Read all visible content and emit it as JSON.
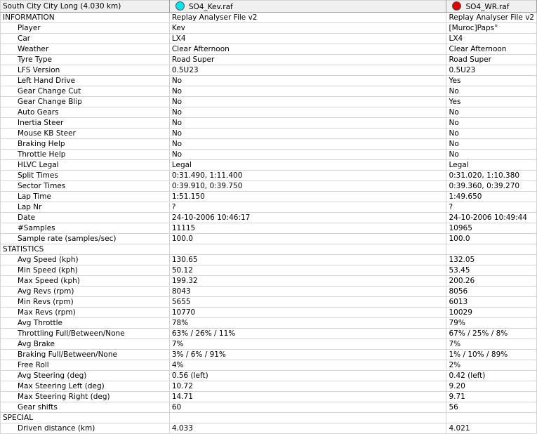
{
  "header": {
    "track": "South City City Long (4.030 km)",
    "file1": {
      "name": "SO4_Kev.raf",
      "color": "#00e5ee",
      "icon": "cyan-dot-icon"
    },
    "file2": {
      "name": "SO4_WR.raf",
      "color": "#e00000",
      "icon": "red-dot-icon"
    }
  },
  "rows": [
    {
      "label": "INFORMATION",
      "section": true,
      "v1": "Replay Analyser File v2",
      "v2": "Replay Analyser File v2"
    },
    {
      "label": "Player",
      "v1": "Kev",
      "v2": "[Muroc]Paps°"
    },
    {
      "label": "Car",
      "v1": "LX4",
      "v2": "LX4"
    },
    {
      "label": "Weather",
      "v1": "Clear Afternoon",
      "v2": "Clear Afternoon"
    },
    {
      "label": "Tyre Type",
      "v1": "Road Super",
      "v2": "Road Super"
    },
    {
      "label": "LFS Version",
      "v1": "0.5U23",
      "v2": "0.5U23"
    },
    {
      "label": "Left Hand Drive",
      "v1": "No",
      "v2": "Yes"
    },
    {
      "label": "Gear Change Cut",
      "v1": "No",
      "v2": "No"
    },
    {
      "label": "Gear Change Blip",
      "v1": "No",
      "v2": "Yes"
    },
    {
      "label": "Auto Gears",
      "v1": "No",
      "v2": "No"
    },
    {
      "label": "Inertia Steer",
      "v1": "No",
      "v2": "No"
    },
    {
      "label": "Mouse KB Steer",
      "v1": "No",
      "v2": "No"
    },
    {
      "label": "Braking Help",
      "v1": "No",
      "v2": "No"
    },
    {
      "label": "Throttle Help",
      "v1": "No",
      "v2": "No"
    },
    {
      "label": "HLVC Legal",
      "v1": "Legal",
      "v2": "Legal"
    },
    {
      "label": "Split Times",
      "v1": "0:31.490, 1:11.400",
      "v2": "0:31.020, 1:10.380"
    },
    {
      "label": "Sector Times",
      "v1": "0:39.910, 0:39.750",
      "v2": "0:39.360, 0:39.270"
    },
    {
      "label": "Lap Time",
      "v1": "1:51.150",
      "v2": "1:49.650"
    },
    {
      "label": "Lap Nr",
      "v1": "?",
      "v2": "?"
    },
    {
      "label": "Date",
      "v1": "24-10-2006 10:46:17",
      "v2": "24-10-2006 10:49:44"
    },
    {
      "label": "#Samples",
      "v1": "11115",
      "v2": "10965"
    },
    {
      "label": "Sample rate (samples/sec)",
      "v1": "100.0",
      "v2": "100.0"
    },
    {
      "label": "STATISTICS",
      "section": true,
      "v1": "",
      "v2": ""
    },
    {
      "label": "Avg Speed (kph)",
      "v1": "130.65",
      "v2": "132.05"
    },
    {
      "label": "Min Speed (kph)",
      "v1": "50.12",
      "v2": "53.45"
    },
    {
      "label": "Max Speed (kph)",
      "v1": "199.32",
      "v2": "200.26"
    },
    {
      "label": "Avg Revs (rpm)",
      "v1": "8043",
      "v2": "8056"
    },
    {
      "label": "Min Revs (rpm)",
      "v1": "5655",
      "v2": "6013"
    },
    {
      "label": "Max Revs (rpm)",
      "v1": "10770",
      "v2": "10029"
    },
    {
      "label": "Avg Throttle",
      "v1": "78%",
      "v2": "79%"
    },
    {
      "label": "Throttling Full/Between/None",
      "v1": "63% / 26% / 11%",
      "v2": "67% / 25% / 8%"
    },
    {
      "label": "Avg Brake",
      "v1": "7%",
      "v2": "7%"
    },
    {
      "label": "Braking Full/Between/None",
      "v1": "3% / 6% / 91%",
      "v2": "1% / 10% / 89%"
    },
    {
      "label": "Free Roll",
      "v1": "4%",
      "v2": "2%"
    },
    {
      "label": "Avg Steering (deg)",
      "v1": "0.56 (left)",
      "v2": "0.42 (left)"
    },
    {
      "label": "Max Steering Left (deg)",
      "v1": "10.72",
      "v2": "9.20"
    },
    {
      "label": "Max Steering Right (deg)",
      "v1": "14.71",
      "v2": "9.71"
    },
    {
      "label": "Gear shifts",
      "v1": "60",
      "v2": "56"
    },
    {
      "label": "SPECIAL",
      "section": true,
      "v1": "",
      "v2": ""
    },
    {
      "label": "Driven distance (km)",
      "v1": "4.033",
      "v2": "4.021"
    }
  ]
}
